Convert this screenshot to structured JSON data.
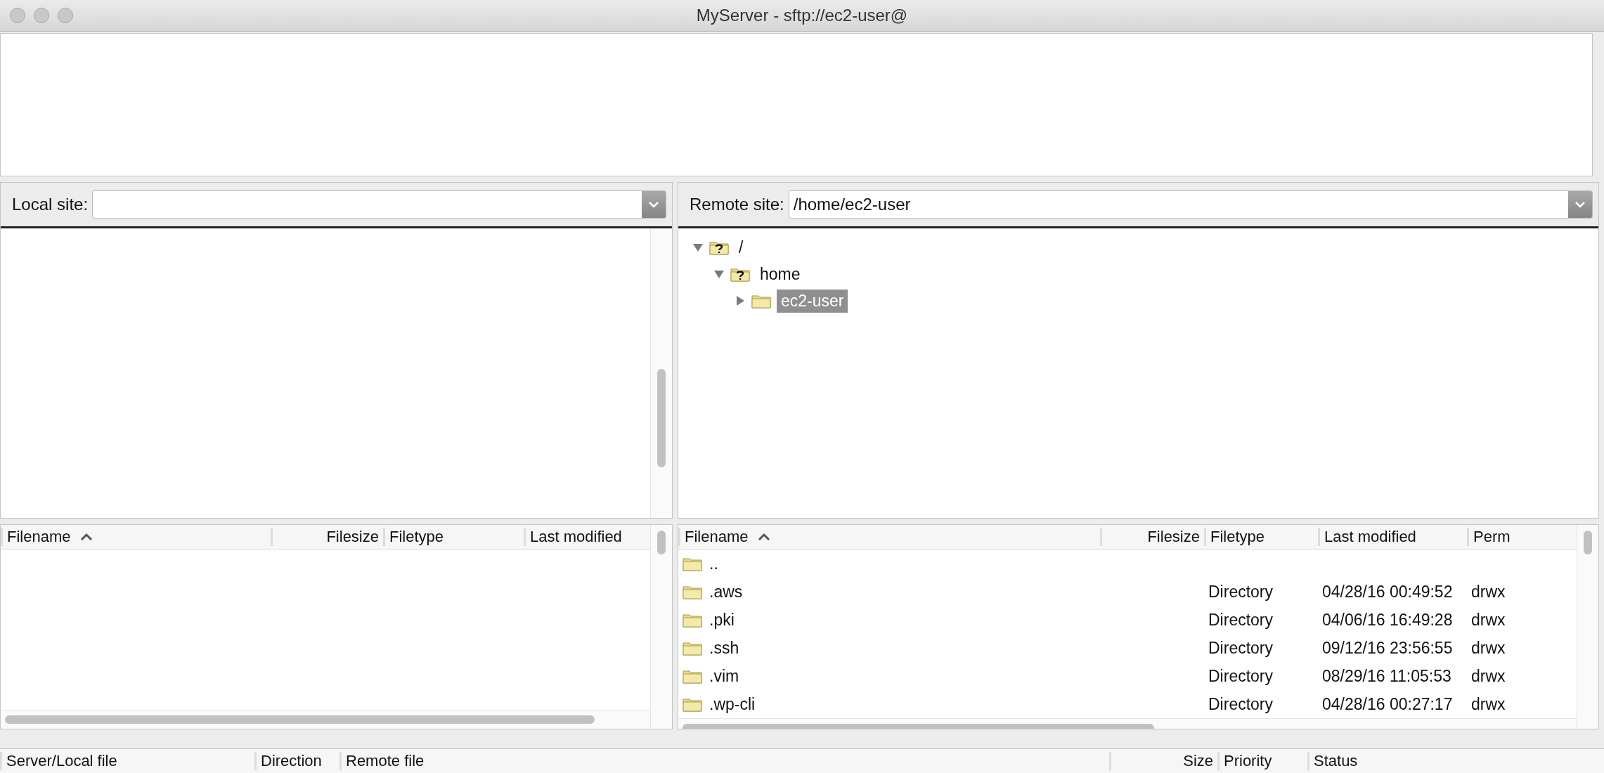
{
  "window": {
    "title": "MyServer - sftp://ec2-user@"
  },
  "local_site": {
    "label": "Local site:"
  },
  "remote_site": {
    "label": "Remote site:",
    "path": "/home/ec2-user"
  },
  "remote_tree": [
    {
      "label": "/",
      "kind": "unknown",
      "expanded": true,
      "selected": false,
      "children": [
        {
          "label": "home",
          "kind": "unknown",
          "expanded": true,
          "selected": false,
          "children": [
            {
              "label": "ec2-user",
              "kind": "folder",
              "expanded": false,
              "selected": true
            }
          ]
        }
      ]
    }
  ],
  "local_files": {
    "columns": [
      {
        "label": "Filename",
        "sorted": true
      },
      {
        "label": "Filesize",
        "sorted": false
      },
      {
        "label": "Filetype",
        "sorted": false
      },
      {
        "label": "Last modified",
        "sorted": false
      }
    ]
  },
  "remote_files": {
    "columns": [
      {
        "label": "Filename",
        "sorted": true
      },
      {
        "label": "Filesize",
        "sorted": false
      },
      {
        "label": "Filetype",
        "sorted": false
      },
      {
        "label": "Last modified",
        "sorted": false
      },
      {
        "label": "Perm",
        "sorted": false
      }
    ],
    "rows": [
      {
        "name": ".."
      },
      {
        "name": ".aws",
        "filetype": "Directory",
        "last_modified": "04/28/16 00:49:52",
        "permissions": "drwx"
      },
      {
        "name": ".pki",
        "filetype": "Directory",
        "last_modified": "04/06/16 16:49:28",
        "permissions": "drwx"
      },
      {
        "name": ".ssh",
        "filetype": "Directory",
        "last_modified": "09/12/16 23:56:55",
        "permissions": "drwx"
      },
      {
        "name": ".vim",
        "filetype": "Directory",
        "last_modified": "08/29/16 11:05:53",
        "permissions": "drwx"
      },
      {
        "name": ".wp-cli",
        "filetype": "Directory",
        "last_modified": "04/28/16 00:27:17",
        "permissions": "drwx"
      }
    ]
  },
  "transfer_queue": {
    "columns": [
      {
        "label": "Server/Local file"
      },
      {
        "label": "Direction"
      },
      {
        "label": "Remote file"
      },
      {
        "label": "Size"
      },
      {
        "label": "Priority"
      },
      {
        "label": "Status"
      }
    ]
  }
}
